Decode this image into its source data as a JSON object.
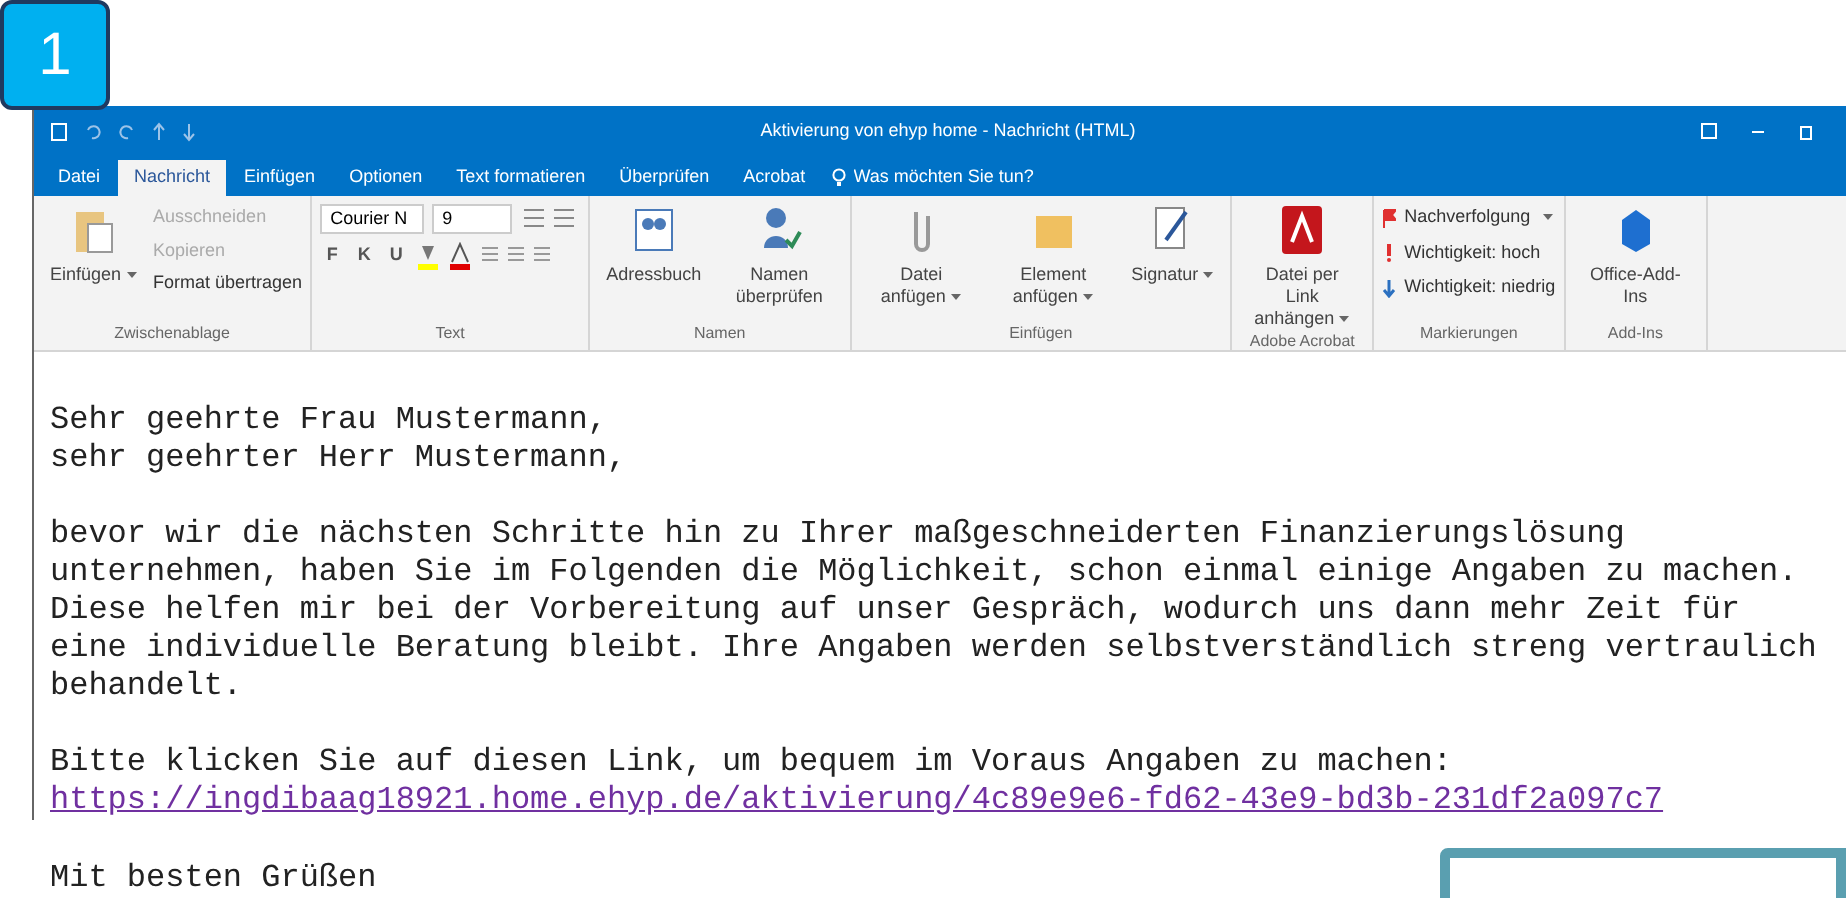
{
  "badge": "1",
  "window": {
    "title": "Aktivierung von ehyp home - Nachricht (HTML)"
  },
  "tabs": [
    {
      "label": "Datei",
      "selected": false
    },
    {
      "label": "Nachricht",
      "selected": true
    },
    {
      "label": "Einfügen",
      "selected": false
    },
    {
      "label": "Optionen",
      "selected": false
    },
    {
      "label": "Text formatieren",
      "selected": false
    },
    {
      "label": "Überprüfen",
      "selected": false
    },
    {
      "label": "Acrobat",
      "selected": false
    }
  ],
  "tell_me": {
    "placeholder": "Was möchten Sie tun?"
  },
  "ribbon": {
    "clipboard": {
      "label": "Zwischenablage",
      "paste": "Einfügen",
      "items": [
        {
          "label": "Ausschneiden",
          "disabled": true
        },
        {
          "label": "Kopieren",
          "disabled": true
        },
        {
          "label": "Format übertragen",
          "disabled": false
        }
      ]
    },
    "text": {
      "label": "Text",
      "font": "Courier N",
      "size": "9",
      "format_buttons": [
        "F",
        "K",
        "U"
      ]
    },
    "names": {
      "label": "Namen",
      "items": [
        "Adressbuch",
        "Namen überprüfen"
      ]
    },
    "insert": {
      "label": "Einfügen",
      "items": [
        "Datei anfügen",
        "Element anfügen",
        "Signatur"
      ]
    },
    "acrobat": {
      "label": "Adobe Acrobat",
      "item": "Datei per Link anhängen"
    },
    "tags": {
      "label": "Markierungen",
      "items": [
        {
          "kind": "flag",
          "label": "Nachverfolgung"
        },
        {
          "kind": "high",
          "label": "Wichtigkeit: hoch"
        },
        {
          "kind": "low",
          "label": "Wichtigkeit: niedrig"
        }
      ]
    },
    "addins": {
      "label": "Add-Ins",
      "item": "Office-Add-Ins"
    }
  },
  "body": {
    "greeting": [
      "Sehr geehrte Frau Mustermann,",
      "sehr geehrter Herr Mustermann,"
    ],
    "paragraph": "bevor wir die nächsten Schritte hin zu Ihrer maßgeschneiderten Finanzierungslösung unternehmen, haben Sie im Folgenden die Möglichkeit, schon einmal einige Angaben zu machen. Diese helfen mir bei der Vorbereitung auf unser Gespräch, wodurch uns dann mehr Zeit für eine individuelle Beratung bleibt. Ihre Angaben werden selbstverständlich streng vertraulich behandelt.",
    "link_intro": "Bitte klicken Sie auf diesen Link, um bequem im Voraus Angaben zu machen:",
    "link": "https://ingdibaag18921.home.ehyp.de/aktivierung/4c89e9e6-fd62-43e9-bd3b-231df2a097c7",
    "closing": "Mit besten Grüßen"
  }
}
